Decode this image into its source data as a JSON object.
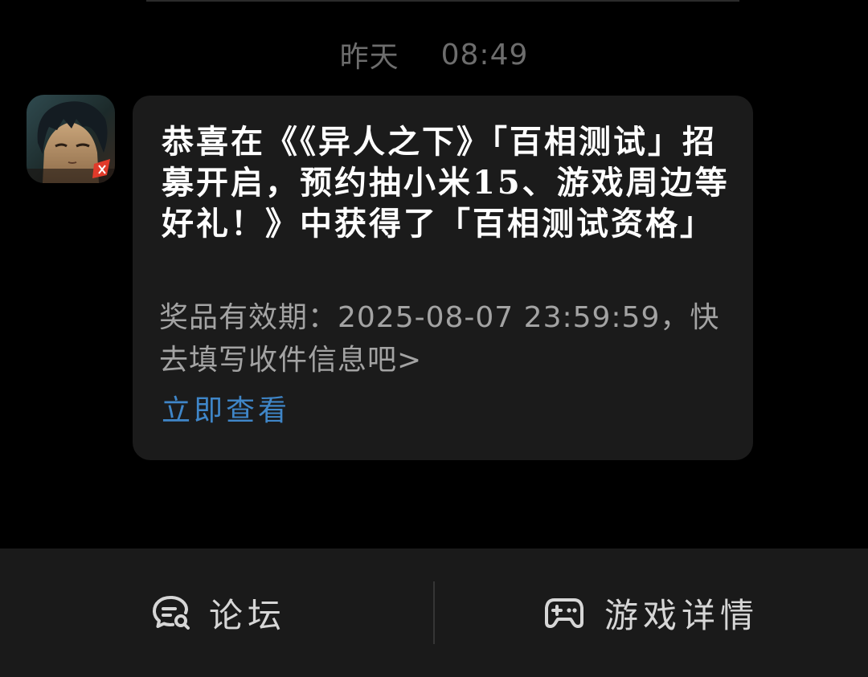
{
  "timestamp": {
    "day": "昨天",
    "time": "08:49"
  },
  "message": {
    "avatar_icon": "game-app-avatar",
    "title": "恭喜在《《异人之下》「百相测试」招募开启，预约抽小米15、游戏周边等好礼！》中获得了「百相测试资格」",
    "body": "奖品有效期：2025-08-07 23:59:59，快去填写收件信息吧>",
    "link": "立即查看"
  },
  "bottom_bar": {
    "forum": {
      "label": "论坛",
      "icon": "forum-chat-icon"
    },
    "game_details": {
      "label": "游戏详情",
      "icon": "gamepad-icon"
    }
  },
  "colors": {
    "background": "#000000",
    "bubble": "#1b1b1b",
    "bottom_bar": "#1a1a1a",
    "link": "#3f86c8",
    "secondary_text": "#a3a3a3",
    "timestamp_text": "#6d6d6d"
  }
}
